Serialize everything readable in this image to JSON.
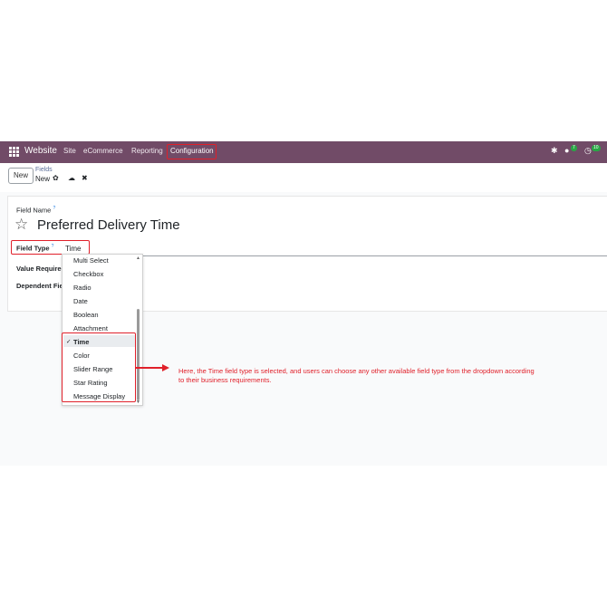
{
  "navbar": {
    "app_name": "Website",
    "menus": [
      "Site",
      "eCommerce",
      "Reporting",
      "Configuration"
    ],
    "chat_count": "7",
    "activity_count": "10"
  },
  "control_panel": {
    "new_button": "New",
    "breadcrumb_parent": "Fields",
    "breadcrumb_current": "New"
  },
  "form": {
    "field_name_label": "Field Name",
    "field_name_value": "Preferred Delivery Time",
    "field_type_label": "Field Type",
    "field_type_value": "Time",
    "value_required_label": "Value Required",
    "dependent_field_label": "Dependent Field",
    "help_mark": "?"
  },
  "dropdown": {
    "options": [
      "Multi Select",
      "Checkbox",
      "Radio",
      "Date",
      "Boolean",
      "Attachment",
      "Time",
      "Color",
      "Slider Range",
      "Star Rating",
      "Message Display"
    ],
    "selected": "Time"
  },
  "annotation": {
    "text": "Here, the Time field type is selected, and users can choose any other available field type from the dropdown according to their business requirements."
  },
  "colors": {
    "navbar": "#714b67",
    "annotation_red": "#e0202a"
  }
}
